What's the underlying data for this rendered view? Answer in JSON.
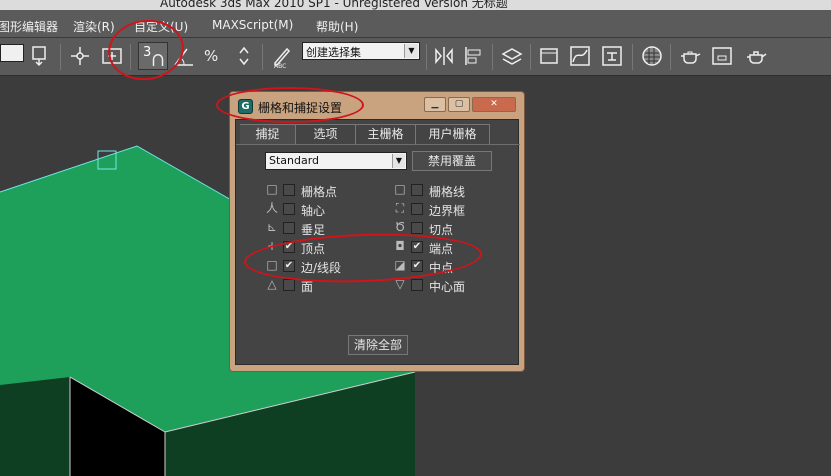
{
  "window": {
    "title": "Autodesk 3ds Max  2010 SP1  -  Unregistered Version      无标题"
  },
  "menubar": {
    "items": [
      "图形编辑器",
      "渲染(R)",
      "自定义(U)",
      "MAXScript(M)",
      "帮助(H)"
    ]
  },
  "toolbar": {
    "snap_value": "3",
    "selection_set_placeholder": "创建选择集"
  },
  "dialog": {
    "title": "栅格和捕捉设置",
    "logo": "G",
    "tabs": [
      "捕捉",
      "选项",
      "主栅格",
      "用户栅格"
    ],
    "dropdown_value": "Standard",
    "override_button": "禁用覆盖",
    "clear_button": "清除全部",
    "left_options": [
      {
        "symbol": "square-icon",
        "glyph": "□",
        "label": "栅格点",
        "checked": false
      },
      {
        "symbol": "pivot-icon",
        "glyph": "人",
        "label": "轴心",
        "checked": false
      },
      {
        "symbol": "perpendicular-icon",
        "glyph": "⊾",
        "label": "垂足",
        "checked": false
      },
      {
        "symbol": "cross-icon",
        "glyph": "+",
        "label": "顶点",
        "checked": true
      },
      {
        "symbol": "square-icon",
        "glyph": "□",
        "label": "边/线段",
        "checked": true
      },
      {
        "symbol": "triangle-icon",
        "glyph": "△",
        "label": "面",
        "checked": false
      }
    ],
    "right_options": [
      {
        "symbol": "square-icon",
        "glyph": "□",
        "label": "栅格线",
        "checked": false
      },
      {
        "symbol": "bounding-box-icon",
        "glyph": "⛶",
        "label": "边界框",
        "checked": false
      },
      {
        "symbol": "tangent-icon",
        "glyph": "Ծ",
        "label": "切点",
        "checked": false
      },
      {
        "symbol": "endpoint-icon",
        "glyph": "◘",
        "label": "端点",
        "checked": true
      },
      {
        "symbol": "midpoint-icon",
        "glyph": "◪",
        "label": "中点",
        "checked": true
      },
      {
        "symbol": "center-face-icon",
        "glyph": "▽",
        "label": "中心面",
        "checked": false
      }
    ]
  },
  "colors": {
    "accent_red": "#d0141a",
    "mesh_green": "#1fa05a",
    "mesh_dark": "#0f3f22",
    "wire_cyan": "#6fe8e8"
  }
}
